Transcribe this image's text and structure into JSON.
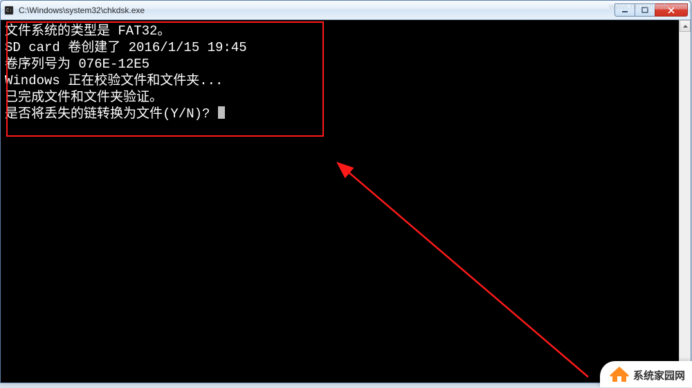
{
  "window": {
    "title": "C:\\Windows\\system32\\chkdsk.exe"
  },
  "terminal": {
    "lines": [
      "文件系统的类型是 FAT32。",
      "SD card 卷创建了 2016/1/15 19:45",
      "卷序列号为 076E-12E5",
      "Windows 正在校验文件和文件夹...",
      "已完成文件和文件夹验证。",
      "是否将丢失的链转换为文件(Y/N)? "
    ]
  },
  "watermark": {
    "top": "www.hnzkhbsb.com",
    "bottom": "系统家园网"
  }
}
